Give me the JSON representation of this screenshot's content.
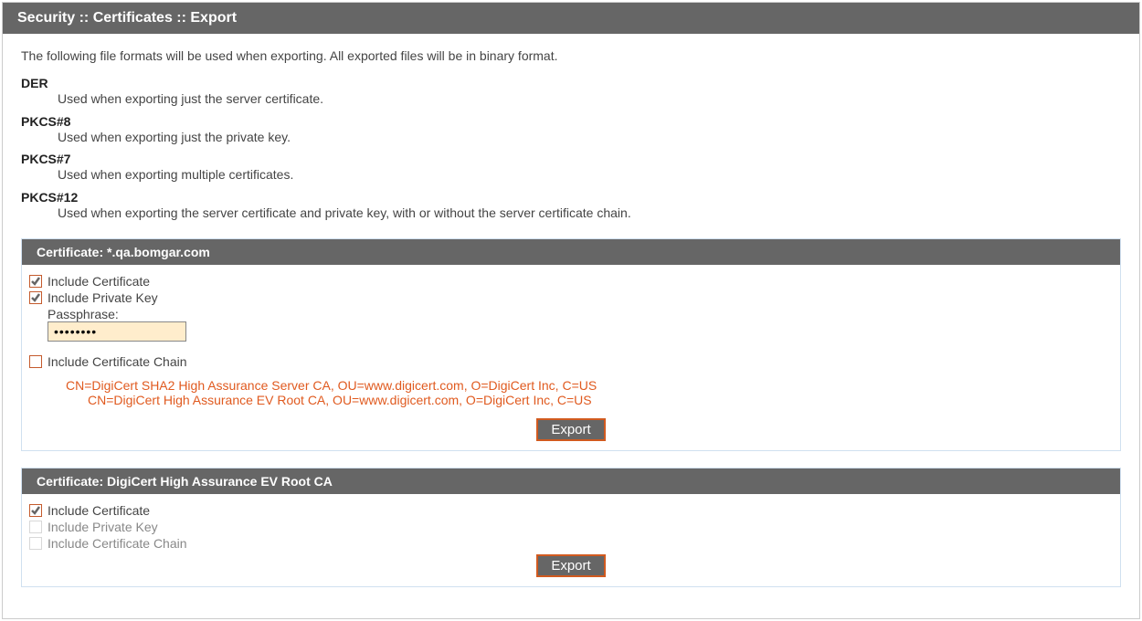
{
  "page": {
    "title_bar": "Security :: Certificates :: Export",
    "intro": "The following file formats will be used when exporting. All exported files will be in binary format."
  },
  "formats": {
    "der_label": "DER",
    "der_desc": "Used when exporting just the server certificate.",
    "pkcs8_label": "PKCS#8",
    "pkcs8_desc": "Used when exporting just the private key.",
    "pkcs7_label": "PKCS#7",
    "pkcs7_desc": "Used when exporting multiple certificates.",
    "pkcs12_label": "PKCS#12",
    "pkcs12_desc": "Used when exporting the server certificate and private key, with or without the server certificate chain."
  },
  "cert1": {
    "header": "Certificate: *.qa.bomgar.com",
    "include_cert_label": "Include Certificate",
    "include_key_label": "Include Private Key",
    "passphrase_label": "Passphrase:",
    "passphrase_value": "••••••••",
    "include_chain_label": "Include Certificate Chain",
    "chain_line1": "CN=DigiCert SHA2 High Assurance Server CA, OU=www.digicert.com, O=DigiCert Inc, C=US",
    "chain_line2": "CN=DigiCert High Assurance EV Root CA, OU=www.digicert.com, O=DigiCert Inc, C=US",
    "export_btn": "Export"
  },
  "cert2": {
    "header": "Certificate: DigiCert High Assurance EV Root CA",
    "include_cert_label": "Include Certificate",
    "include_key_label": "Include Private Key",
    "include_chain_label": "Include Certificate Chain",
    "export_btn": "Export"
  }
}
